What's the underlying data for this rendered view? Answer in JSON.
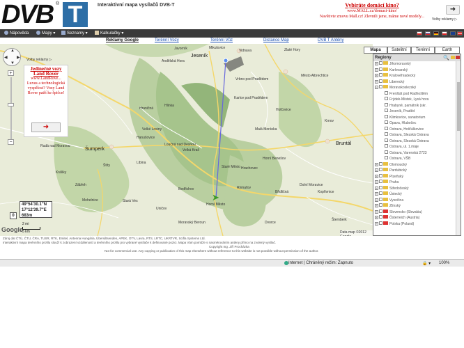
{
  "header": {
    "logo_dvb": "DVB",
    "logo_reg": "®",
    "logo_t": "T",
    "title": "Interaktivní mapa vysílačů DVB-T",
    "ad_title": "Vybíráte domácí kino?",
    "ad_url": "www.MALL.cz/domaci-kino/",
    "ad_text": "Navštivte zmovu Mall.cz! Zlevnili jsme, máme nové modely...",
    "ad_label": "Volby reklamy ▷"
  },
  "toolbar": {
    "help": "Nápověda",
    "maps": "Mapy",
    "lists": "Seznamy",
    "calculators": "Kalkulačky"
  },
  "links": [
    "Reklamy Google",
    "Terénní Vozy",
    "Terénní Vůz",
    "Distance Map",
    "DVB T Antény"
  ],
  "map_types": [
    "Mapa",
    "Satelitní",
    "Terénní",
    "Earth"
  ],
  "map": {
    "ad_label": "Volby reklamy ▷",
    "ad_title": "Jedinečné vozy Land Rover",
    "ad_url": "www.LandRove...",
    "ad_text": "Luxus a technologická vyspělost? Vozy Land Rover patří ke špičce!",
    "towns": [
      {
        "n": "Jeseník"
      },
      {
        "n": "Andělská Hora"
      },
      {
        "n": "Vidnava"
      },
      {
        "n": "Javorník"
      },
      {
        "n": "Zlaté Hory"
      },
      {
        "n": "Mikulovice"
      },
      {
        "n": "Vrbno pod Pradědem"
      },
      {
        "n": "Město Albrechtice"
      },
      {
        "n": "Krnov"
      },
      {
        "n": "Bruntál"
      },
      {
        "n": "Karlov pod Pradědem"
      },
      {
        "n": "Šumperk"
      },
      {
        "n": "Staré Město"
      },
      {
        "n": "Hanušovice"
      },
      {
        "n": "Loučná nad Desnou"
      },
      {
        "n": "Velké Losiny"
      },
      {
        "n": "Libina"
      },
      {
        "n": "Zábřeh"
      },
      {
        "n": "Mohelnice"
      },
      {
        "n": "Uničov"
      },
      {
        "n": "Rýmařov"
      },
      {
        "n": "Břidličná"
      },
      {
        "n": "Horní Benešov"
      },
      {
        "n": "Horní Město"
      },
      {
        "n": "Štíty"
      },
      {
        "n": "Králíky"
      },
      {
        "n": "Rudá nad Moravou"
      },
      {
        "n": "Hrachovec"
      },
      {
        "n": "Velká Kraš"
      },
      {
        "n": "Holčovice"
      },
      {
        "n": "Hlinka"
      },
      {
        "n": "Stará Ves"
      },
      {
        "n": "Bedřichov"
      },
      {
        "n": "Hraničná"
      },
      {
        "n": "Malá Morávka"
      },
      {
        "n": "Dolní Moravice"
      },
      {
        "n": "Kopřivnice"
      },
      {
        "n": "Moravský Beroun"
      },
      {
        "n": "Šternberk"
      },
      {
        "n": "Dvorce"
      }
    ],
    "coord_lat": "49°54'30.1\"N",
    "coord_lon": "17°12'39.7\"E",
    "coord_alt": "683m",
    "zero": "0",
    "scale_top": "2 mi",
    "scale_bottom": "5 km",
    "zoom_plus": "+",
    "zoom_minus": "−",
    "nav_up": "▲",
    "nav_down": "▼",
    "nav_left": "◀",
    "nav_right": "▶",
    "google": "Google",
    "copyright": "Data map ©2012 Google"
  },
  "regions": {
    "title": "Regiony",
    "items": [
      {
        "t": "Jihomoravský",
        "lvl": 0
      },
      {
        "t": "Karlovarský",
        "lvl": 0
      },
      {
        "t": "Královéhradecký",
        "lvl": 0
      },
      {
        "t": "Liberecký",
        "lvl": 0
      },
      {
        "t": "Moravskoslezský",
        "lvl": 0
      },
      {
        "t": "Frenštát pod Radhoštěm",
        "lvl": 1
      },
      {
        "t": "Frýdek-Místek, Lysá hora",
        "lvl": 1
      },
      {
        "t": "Hrabyně, památník (skr.",
        "lvl": 1
      },
      {
        "t": "Jeseník, Praděd",
        "lvl": 1
      },
      {
        "t": "Klimkovice, sanatorium",
        "lvl": 1
      },
      {
        "t": "Opava, Hlubočec",
        "lvl": 1
      },
      {
        "t": "Ostrava, Hošťálkovice",
        "lvl": 1
      },
      {
        "t": "Ostrava, Slezská Ostrava",
        "lvl": 1
      },
      {
        "t": "Ostrava, Slezská Ostrava",
        "lvl": 1
      },
      {
        "t": "Ostrava, ul. 1.máje",
        "lvl": 1
      },
      {
        "t": "Ostrava, Varenská 2723",
        "lvl": 1
      },
      {
        "t": "Ostrava, VŠB",
        "lvl": 1
      },
      {
        "t": "Olomoucký",
        "lvl": 0
      },
      {
        "t": "Pardubický",
        "lvl": 0
      },
      {
        "t": "Plzeňský",
        "lvl": 0
      },
      {
        "t": "Praha",
        "lvl": 0
      },
      {
        "t": "Středočeský",
        "lvl": 0
      },
      {
        "t": "Ústecký",
        "lvl": 0
      },
      {
        "t": "Vysočina",
        "lvl": 0
      },
      {
        "t": "Zlínský",
        "lvl": 0
      },
      {
        "t": "Slovensko (Slovakia)",
        "lvl": 2
      },
      {
        "t": "Österreich (Austria)",
        "lvl": 2
      },
      {
        "t": "Polska (Poland)",
        "lvl": 2
      }
    ]
  },
  "footer": {
    "line1": "Zdroj dat ČTÚ, ČTU, ČRA, TUSR, RTK, Emitel, Antenna Hungária, Übersiltsenden, APEK, OTV, Lavra, RTS, LRTC, UKRTVR, Scifla Systems Ltd.",
    "line2": "Interaktivní mapa terénního profilu slouží k zobrazení vzdáleností a terénního profilu pro vybrané vysílače k definované pozici. Mapa Vám pomůže s nasměrováním antény přímo na zvolený vysílač.",
    "line3": "Copyright Ing. Jiří Procházka",
    "line4": "Not for commercial use. Any copying or publication of this map elsewhere without reference to this website is not possible without permission of the author."
  },
  "status": {
    "text": "Internet | Chráněný režim: Zapnuto",
    "zoom": "100%"
  },
  "colors": {
    "map_bg": "#e9ecd9",
    "forest": "#b9cfa0",
    "road": "#f4d76a",
    "line": "#6666dd",
    "toolbar": "#3a3a3a",
    "ad": "#cc0000"
  }
}
